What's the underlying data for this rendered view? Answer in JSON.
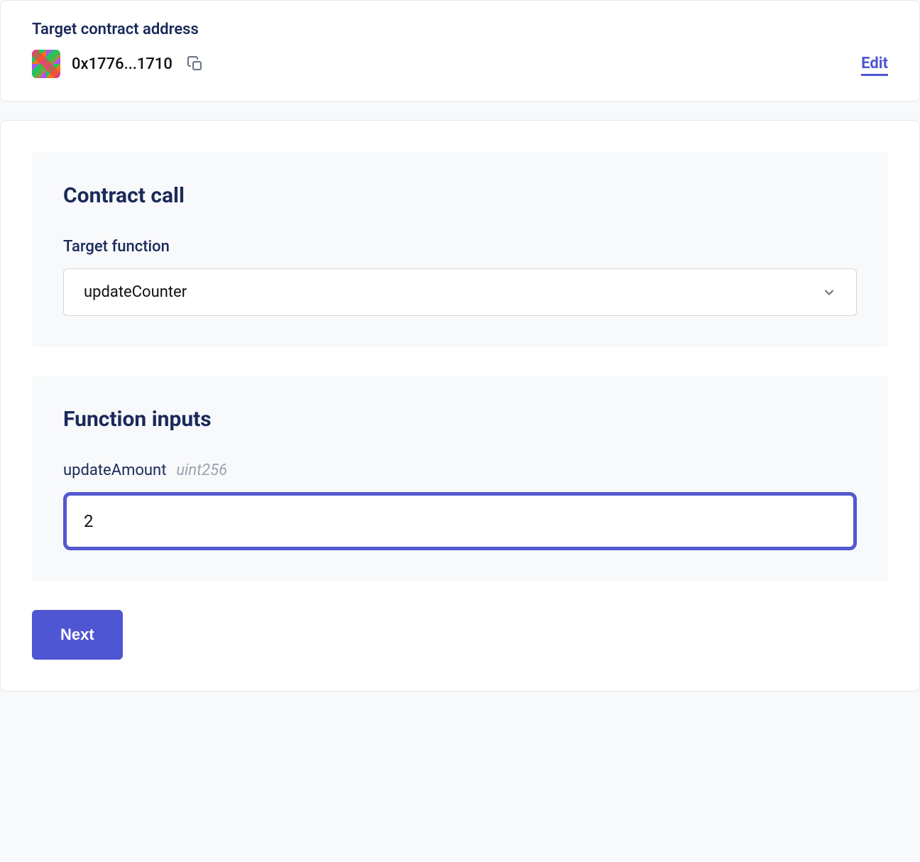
{
  "header": {
    "title": "Target contract address",
    "address": "0x1776...1710",
    "edit_label": "Edit"
  },
  "contract_call": {
    "section_title": "Contract call",
    "field_label": "Target function",
    "selected_function": "updateCounter"
  },
  "function_inputs": {
    "section_title": "Function inputs",
    "inputs": [
      {
        "name": "updateAmount",
        "type": "uint256",
        "value": "2"
      }
    ]
  },
  "actions": {
    "next_label": "Next"
  }
}
